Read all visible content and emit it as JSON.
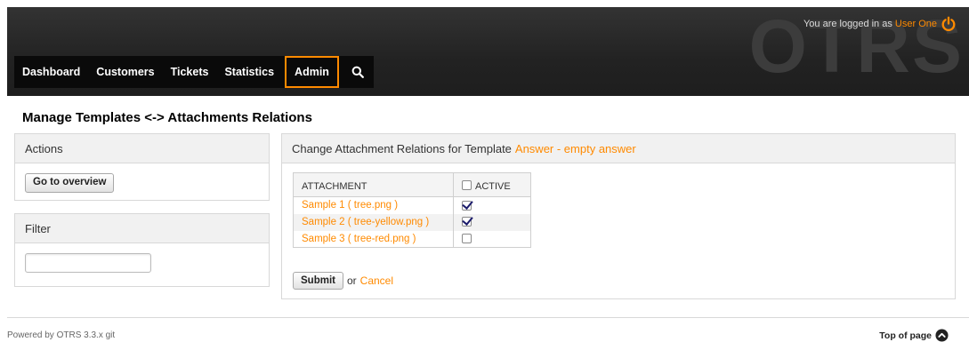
{
  "header": {
    "logo": "OTRS",
    "login_prefix": "You are logged in as",
    "user": "User One",
    "icons": {
      "logout": "power-icon",
      "search": "search-icon"
    },
    "colors": {
      "accent": "#ff8a00",
      "header_bg": "#222222"
    }
  },
  "nav": {
    "items": [
      {
        "label": "Dashboard"
      },
      {
        "label": "Customers"
      },
      {
        "label": "Tickets"
      },
      {
        "label": "Statistics"
      },
      {
        "label": "Admin",
        "active": true
      }
    ]
  },
  "page": {
    "title": "Manage Templates <-> Attachments Relations"
  },
  "sidebar": {
    "actions": {
      "title": "Actions",
      "button": "Go to overview"
    },
    "filter": {
      "title": "Filter",
      "value": ""
    }
  },
  "main": {
    "header_prefix": "Change Attachment Relations for Template",
    "template_name": "Answer - empty answer",
    "table": {
      "col_attachment": "ATTACHMENT",
      "col_active": "ACTIVE",
      "rows": [
        {
          "name": "Sample 1 ( tree.png )",
          "active": true
        },
        {
          "name": "Sample 2 ( tree-yellow.png )",
          "active": true
        },
        {
          "name": "Sample 3 ( tree-red.png )",
          "active": false
        }
      ]
    },
    "submit": "Submit",
    "or": "or",
    "cancel": "Cancel"
  },
  "footer": {
    "powered": "Powered by OTRS 3.3.x git",
    "top_of_page": "Top of page",
    "top_icon": "arrow-up-circle-icon"
  }
}
